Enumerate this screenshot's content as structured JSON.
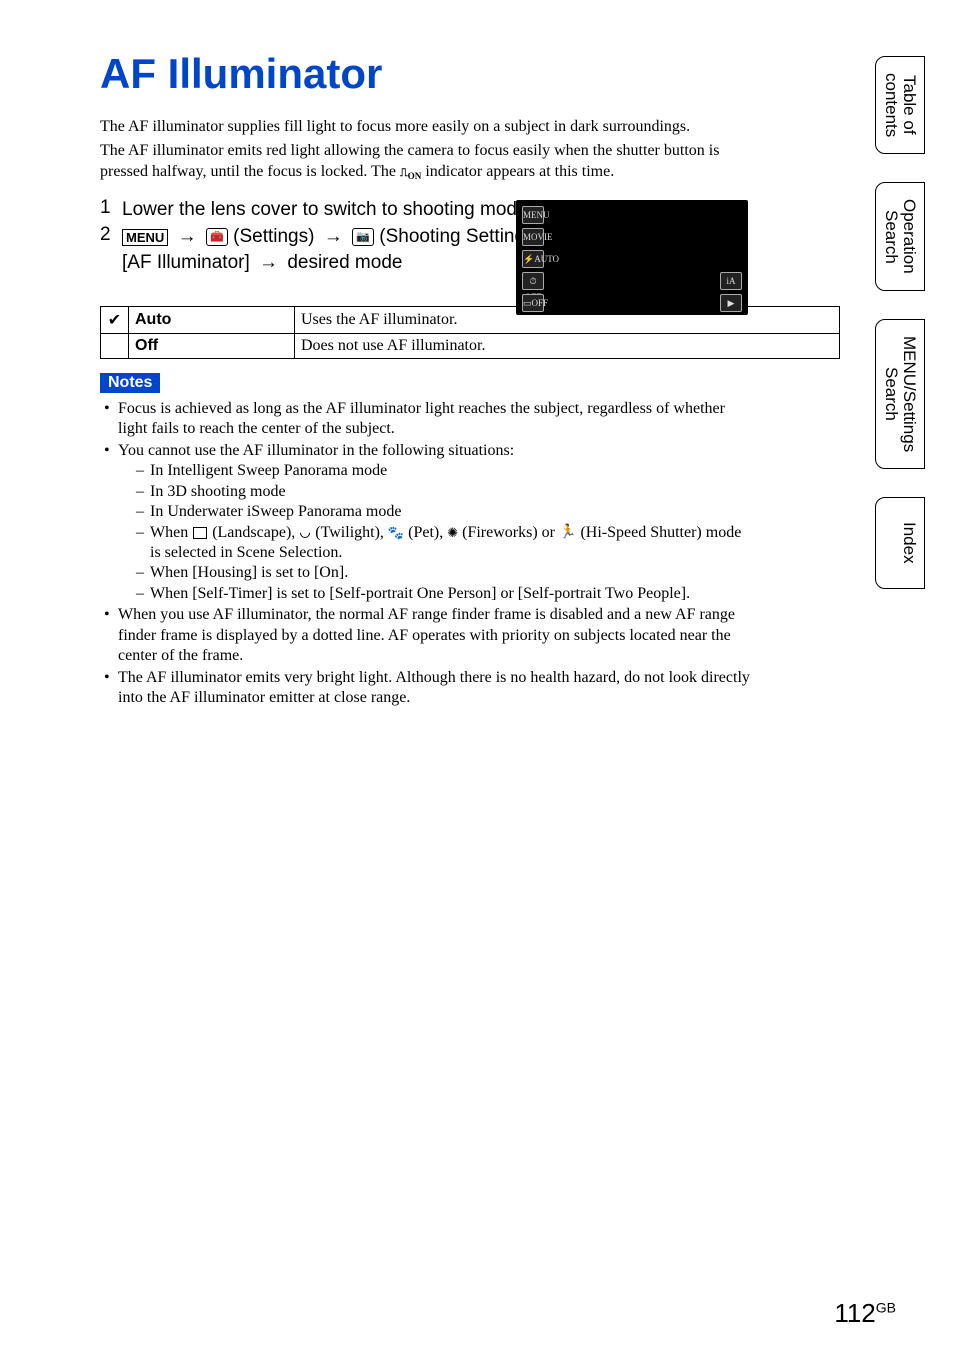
{
  "title": "AF Illuminator",
  "intro": [
    "The AF illuminator supplies fill light to focus more easily on a subject in dark surroundings.",
    "The AF illuminator emits red light allowing the camera to focus easily when the shutter button is pressed halfway, until the focus is locked. The ",
    " indicator appears at this time."
  ],
  "indicator_suffix": "ON",
  "steps": {
    "s1_num": "1",
    "s1_text": "Lower the lens cover to switch to shooting mode.",
    "s2_num": "2",
    "s2_menu": "MENU",
    "s2_settings": "(Settings)",
    "s2_shoot": "(Shooting Settings)",
    "s2_item": "[AF Illuminator]",
    "s2_tail": "desired mode"
  },
  "screenshot_icons": {
    "menu": "MENU",
    "movie": "MOVIE",
    "flash": "⚡AUTO",
    "timer": "⏱OFF",
    "burst": "▭OFF",
    "mode": "iA",
    "play": "▶"
  },
  "options": [
    {
      "check": "✔",
      "label": "Auto",
      "desc": "Uses the AF illuminator."
    },
    {
      "check": "",
      "label": "Off",
      "desc": "Does not use AF illuminator."
    }
  ],
  "notes_title": "Notes",
  "notes": {
    "n1": "Focus is achieved as long as the AF illuminator light reaches the subject, regardless of whether light fails to reach the center of the subject.",
    "n2": "You cannot use the AF illuminator in the following situations:",
    "n2a": "In Intelligent Sweep Panorama mode",
    "n2b": "In 3D shooting mode",
    "n2c": "In Underwater iSweep Panorama mode",
    "n2d_pre": "When ",
    "n2d_land": " (Landscape), ",
    "n2d_twi": " (Twilight), ",
    "n2d_pet": " (Pet), ",
    "n2d_fw": " (Fireworks) or ",
    "n2d_hi": " (Hi-Speed Shutter) mode is selected in Scene Selection.",
    "n2e": "When [Housing] is set to [On].",
    "n2f": "When [Self-Timer] is set to [Self-portrait One Person] or [Self-portrait Two People].",
    "n3": "When you use AF illuminator, the normal AF range finder frame is disabled and a new AF range finder frame is displayed by a dotted line. AF operates with priority on subjects located near the center of the frame.",
    "n4": "The AF illuminator emits very bright light. Although there is no health hazard, do not look directly into the AF illuminator emitter at close range."
  },
  "tabs": {
    "t1a": "Table of",
    "t1b": "contents",
    "t2a": "Operation",
    "t2b": "Search",
    "t3a": "MENU/Settings",
    "t3b": "Search",
    "t4": "Index"
  },
  "page_no": "112",
  "page_no_suffix": "GB"
}
